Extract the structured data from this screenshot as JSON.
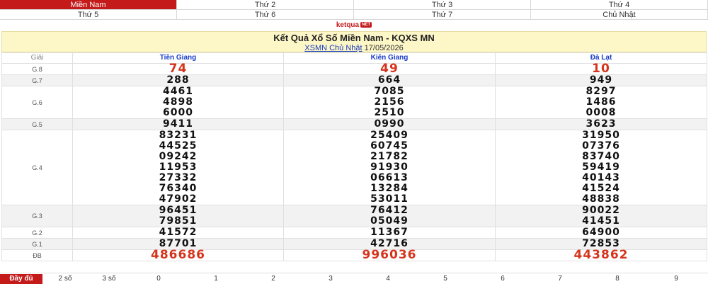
{
  "tabs": [
    {
      "label": "Miền Nam",
      "active": true
    },
    {
      "label": "Thứ 2"
    },
    {
      "label": "Thứ 3"
    },
    {
      "label": "Thứ 4"
    },
    {
      "label": "Thứ 5"
    },
    {
      "label": "Thứ 6"
    },
    {
      "label": "Thứ 7"
    },
    {
      "label": "Chủ Nhật"
    }
  ],
  "brand": {
    "name": "ketqua",
    "badge": "NET"
  },
  "header": {
    "title": "Kết Quả Xổ Số Miền Nam - KQXS MN",
    "link": "XSMN Chủ Nhật",
    "date": "17/05/2026"
  },
  "table": {
    "prize_col": "Giải",
    "provinces": [
      "Tiền Giang",
      "Kiên Giang",
      "Đà Lạt"
    ],
    "rows": [
      {
        "label": "G.8",
        "values": [
          [
            "74"
          ],
          [
            "49"
          ],
          [
            "10"
          ]
        ]
      },
      {
        "label": "G.7",
        "values": [
          [
            "288"
          ],
          [
            "664"
          ],
          [
            "949"
          ]
        ]
      },
      {
        "label": "G.6",
        "values": [
          [
            "4461",
            "4898",
            "6000"
          ],
          [
            "7085",
            "2156",
            "2510"
          ],
          [
            "8297",
            "1486",
            "0008"
          ]
        ]
      },
      {
        "label": "G.5",
        "values": [
          [
            "9411"
          ],
          [
            "0990"
          ],
          [
            "3623"
          ]
        ]
      },
      {
        "label": "G.4",
        "values": [
          [
            "83231",
            "44525",
            "09242",
            "11953",
            "27332",
            "76340",
            "47902"
          ],
          [
            "25409",
            "60745",
            "21782",
            "91930",
            "06613",
            "13284",
            "53011"
          ],
          [
            "31950",
            "07376",
            "83740",
            "59419",
            "40143",
            "41524",
            "48838"
          ]
        ]
      },
      {
        "label": "G.3",
        "values": [
          [
            "96451",
            "79851"
          ],
          [
            "76412",
            "05049"
          ],
          [
            "90022",
            "41451"
          ]
        ]
      },
      {
        "label": "G.2",
        "values": [
          [
            "41572"
          ],
          [
            "11367"
          ],
          [
            "64900"
          ]
        ]
      },
      {
        "label": "G.1",
        "values": [
          [
            "87701"
          ],
          [
            "42716"
          ],
          [
            "72853"
          ]
        ]
      },
      {
        "label": "ĐB",
        "values": [
          [
            "486686"
          ],
          [
            "996036"
          ],
          [
            "443862"
          ]
        ]
      }
    ]
  },
  "footer": {
    "items": [
      "Đầy đủ",
      "2 số",
      "3 số",
      "0",
      "1",
      "2",
      "3",
      "4",
      "5",
      "6",
      "7",
      "8",
      "9"
    ]
  }
}
